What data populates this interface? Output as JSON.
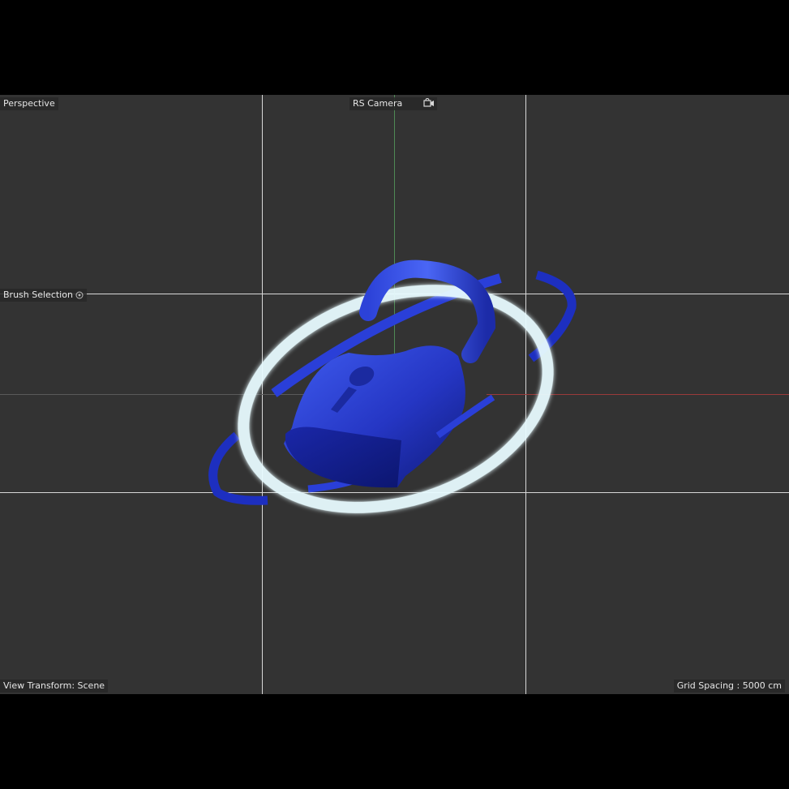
{
  "viewport": {
    "view_name": "Perspective",
    "camera_name": "RS Camera",
    "brush_label": "Brush Selection",
    "view_transform": "View Transform: Scene",
    "grid_spacing": "Grid Spacing : 5000 cm"
  },
  "icons": {
    "camera": "camera-lock-icon",
    "brush": "brush-settings-icon"
  },
  "colors": {
    "viewport_bg": "#333333",
    "object_blue": "#2a3fd0",
    "ring_glow": "#e8fbff",
    "axis_green": "#4f8a55",
    "axis_red": "#9a3a3a"
  }
}
